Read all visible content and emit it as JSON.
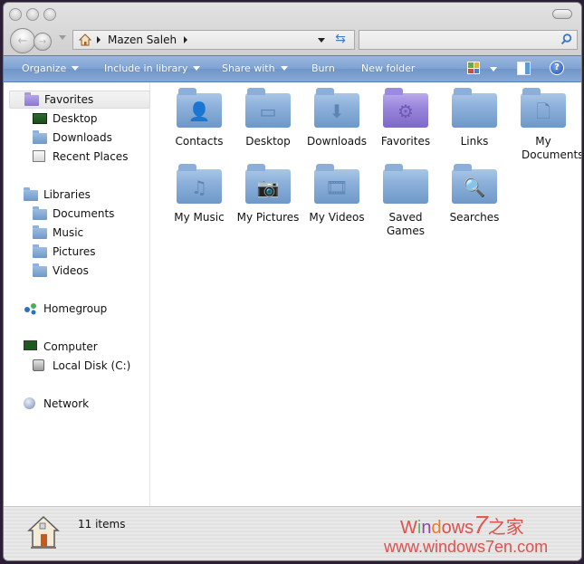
{
  "window": {
    "title_buttons": [
      "close",
      "minimize",
      "zoom"
    ]
  },
  "nav": {
    "back_label": "Back",
    "forward_label": "Forward",
    "address": {
      "root_icon": "home-icon",
      "crumbs": [
        "Mazen Saleh"
      ]
    },
    "search": {
      "placeholder": "",
      "value": ""
    }
  },
  "commandbar": {
    "organize": "Organize",
    "include_in_library": "Include in library",
    "share_with": "Share with",
    "burn": "Burn",
    "new_folder": "New folder",
    "help": "?"
  },
  "sidebar": {
    "favorites": {
      "label": "Favorites",
      "items": [
        "Desktop",
        "Downloads",
        "Recent Places"
      ]
    },
    "libraries": {
      "label": "Libraries",
      "items": [
        "Documents",
        "Music",
        "Pictures",
        "Videos"
      ]
    },
    "homegroup": {
      "label": "Homegroup"
    },
    "computer": {
      "label": "Computer",
      "items": [
        "Local Disk (C:)"
      ]
    },
    "network": {
      "label": "Network"
    }
  },
  "files": [
    {
      "name": "Contacts",
      "icon": "contacts-folder-icon",
      "glyph": "👤"
    },
    {
      "name": "Desktop",
      "icon": "desktop-folder-icon",
      "glyph": "▭"
    },
    {
      "name": "Downloads",
      "icon": "downloads-folder-icon",
      "glyph": "⬇"
    },
    {
      "name": "Favorites",
      "icon": "favorites-folder-icon",
      "glyph": "⚙"
    },
    {
      "name": "Links",
      "icon": "links-folder-icon",
      "glyph": ""
    },
    {
      "name": "My Documents",
      "icon": "documents-folder-icon",
      "glyph": "🗋"
    },
    {
      "name": "My Music",
      "icon": "music-folder-icon",
      "glyph": "♫"
    },
    {
      "name": "My Pictures",
      "icon": "pictures-folder-icon",
      "glyph": "📷"
    },
    {
      "name": "My Videos",
      "icon": "videos-folder-icon",
      "glyph": "🎞"
    },
    {
      "name": "Saved Games",
      "icon": "saved-games-folder-icon",
      "glyph": ""
    },
    {
      "name": "Searches",
      "icon": "searches-folder-icon",
      "glyph": "🔍"
    }
  ],
  "status": {
    "item_count": "11 items"
  },
  "watermark": {
    "line1_prefix": "W",
    "line1_i": "i",
    "line1_n": "n",
    "line1_d": "d",
    "line1_rest": "ows",
    "line1_seven": "7",
    "line1_cn": "之家",
    "line2": "www.windows7en.com"
  }
}
